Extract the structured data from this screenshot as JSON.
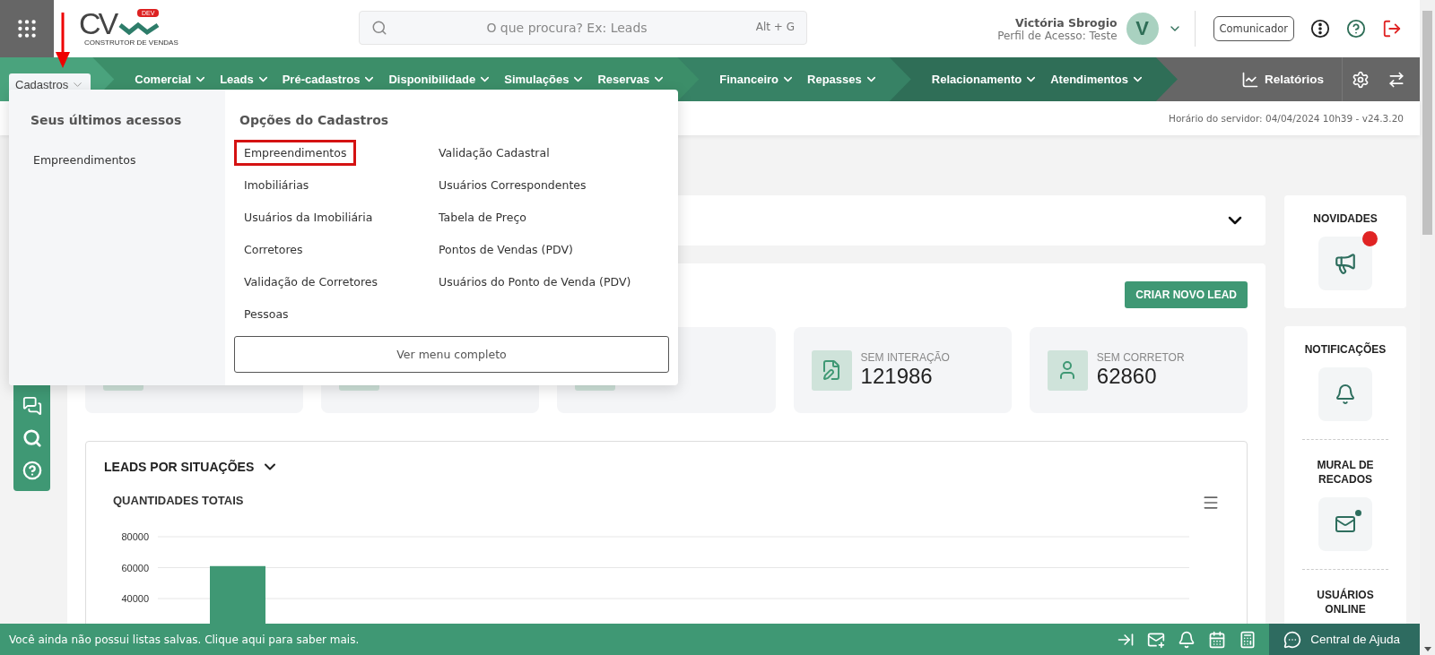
{
  "header": {
    "logo": {
      "mark": "CV",
      "tag": "DEV",
      "caption": "CONSTRUTOR DE VENDAS"
    },
    "search": {
      "placeholder": "O que procura? Ex: Leads",
      "shortcut": "Alt + G"
    },
    "user": {
      "name": "Victória Sbrogio",
      "profile": "Perfil de Acesso: Teste",
      "initial": "V"
    },
    "communicator": "Comunicador"
  },
  "nav": {
    "groups": [
      {
        "items": [
          {
            "label": "Cadastros",
            "selected": true
          }
        ]
      },
      {
        "items": [
          {
            "label": "Comercial",
            "selected": false
          },
          {
            "label": "Leads",
            "selected": false
          },
          {
            "label": "Pré-cadastros",
            "selected": false
          },
          {
            "label": "Disponibilidade",
            "selected": false
          },
          {
            "label": "Simulações",
            "selected": false
          },
          {
            "label": "Reservas",
            "selected": false
          }
        ]
      },
      {
        "items": [
          {
            "label": "Financeiro",
            "selected": false
          },
          {
            "label": "Repasses",
            "selected": false
          }
        ]
      },
      {
        "items": [
          {
            "label": "Relacionamento",
            "selected": false
          },
          {
            "label": "Atendimentos",
            "selected": false
          }
        ]
      }
    ],
    "reports": "Relatórios"
  },
  "server_info": "Horário do servidor: 04/04/2024 10h39 - v24.3.20",
  "dropdown": {
    "recent_title": "Seus últimos acessos",
    "recent": [
      "Empreendimentos"
    ],
    "options_title": "Opções do Cadastros",
    "columns": [
      [
        {
          "label": "Empreendimentos",
          "selected": true
        },
        {
          "label": "Imobiliárias",
          "selected": false
        },
        {
          "label": "Usuários da Imobiliária",
          "selected": false
        },
        {
          "label": "Corretores",
          "selected": false
        },
        {
          "label": "Validação de Corretores",
          "selected": false
        },
        {
          "label": "Pessoas",
          "selected": false
        }
      ],
      [
        {
          "label": "Validação Cadastral",
          "selected": false
        },
        {
          "label": "Usuários Correspondentes",
          "selected": false
        },
        {
          "label": "Tabela de Preço",
          "selected": false
        },
        {
          "label": "Pontos de Vendas (PDV)",
          "selected": false
        },
        {
          "label": "Usuários do Ponto de Venda (PDV)",
          "selected": false
        }
      ]
    ],
    "full_menu": "Ver menu completo"
  },
  "dashboard": {
    "new_lead": "CRIAR NOVO LEAD",
    "stats": [
      {
        "kind": "covered"
      },
      {
        "kind": "covered"
      },
      {
        "kind": "covered"
      },
      {
        "kind": "document",
        "label": "SEM INTERAÇÃO",
        "value": "121986"
      },
      {
        "kind": "person",
        "label": "SEM CORRETOR",
        "value": "62860"
      }
    ],
    "chart_card": {
      "title": "LEADS POR SITUAÇÕES",
      "chart_data": {
        "type": "bar",
        "title": "QUANTIDADES TOTAIS",
        "values": [
          61000
        ],
        "ylim": [
          0,
          80000
        ],
        "yticks": [
          40000,
          60000,
          80000
        ]
      }
    }
  },
  "side": {
    "news": {
      "title": "NOVIDADES",
      "badge": true
    },
    "sections": [
      {
        "kind": "bell",
        "title": "NOTIFICAÇÕES",
        "badge": false
      },
      {
        "kind": "mail",
        "title": "MURAL DE RECADOS",
        "badge": true
      },
      {
        "kind": "users",
        "title": "USUÁRIOS ONLINE"
      }
    ]
  },
  "footer": {
    "message": "Você ainda não possui listas salvas. Clique aqui para saber mais.",
    "help": "Central de Ajuda"
  }
}
